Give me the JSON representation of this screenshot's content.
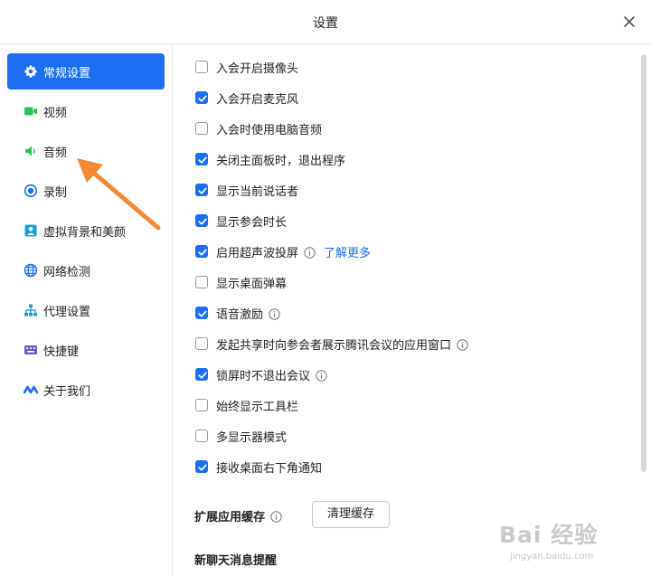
{
  "window": {
    "title": "设置"
  },
  "sidebar": {
    "items": [
      {
        "label": "常规设置",
        "active": true,
        "icon": "gear-icon"
      },
      {
        "label": "视频",
        "icon": "video-camera-icon"
      },
      {
        "label": "音频",
        "icon": "speaker-icon"
      },
      {
        "label": "录制",
        "icon": "record-icon"
      },
      {
        "label": "虚拟背景和美颜",
        "icon": "portrait-icon"
      },
      {
        "label": "网络检测",
        "icon": "globe-icon"
      },
      {
        "label": "代理设置",
        "icon": "network-tree-icon"
      },
      {
        "label": "快捷键",
        "icon": "keyboard-icon"
      },
      {
        "label": "关于我们",
        "icon": "logo-icon"
      }
    ]
  },
  "options": [
    {
      "label": "入会开启摄像头",
      "checked": false
    },
    {
      "label": "入会开启麦克风",
      "checked": true
    },
    {
      "label": "入会时使用电脑音频",
      "checked": false
    },
    {
      "label": "关闭主面板时，退出程序",
      "checked": true
    },
    {
      "label": "显示当前说话者",
      "checked": true
    },
    {
      "label": "显示参会时长",
      "checked": true
    },
    {
      "label": "启用超声波投屏",
      "checked": true,
      "info": true,
      "link": "了解更多"
    },
    {
      "label": "显示桌面弹幕",
      "checked": false
    },
    {
      "label": "语音激励",
      "checked": true,
      "info": true
    },
    {
      "label": "发起共享时向参会者展示腾讯会议的应用窗口",
      "checked": false,
      "info": true
    },
    {
      "label": "锁屏时不退出会议",
      "checked": true,
      "info": true
    },
    {
      "label": "始终显示工具栏",
      "checked": false
    },
    {
      "label": "多显示器模式",
      "checked": false
    },
    {
      "label": "接收桌面右下角通知",
      "checked": true
    }
  ],
  "cache": {
    "title": "扩展应用缓存",
    "button": "清理缓存"
  },
  "chat": {
    "title": "新聊天消息提醒"
  },
  "watermark": {
    "text": "Bai 经验",
    "url": "jingyan.baidu.com"
  },
  "colors": {
    "accent": "#1c6ff0",
    "arrow": "#f28a33",
    "video_icon": "#2fbf5a",
    "audio_icon": "#2fbf5a",
    "record_icon": "#1c6ff0",
    "hotkey_icon": "#6a5acd"
  }
}
